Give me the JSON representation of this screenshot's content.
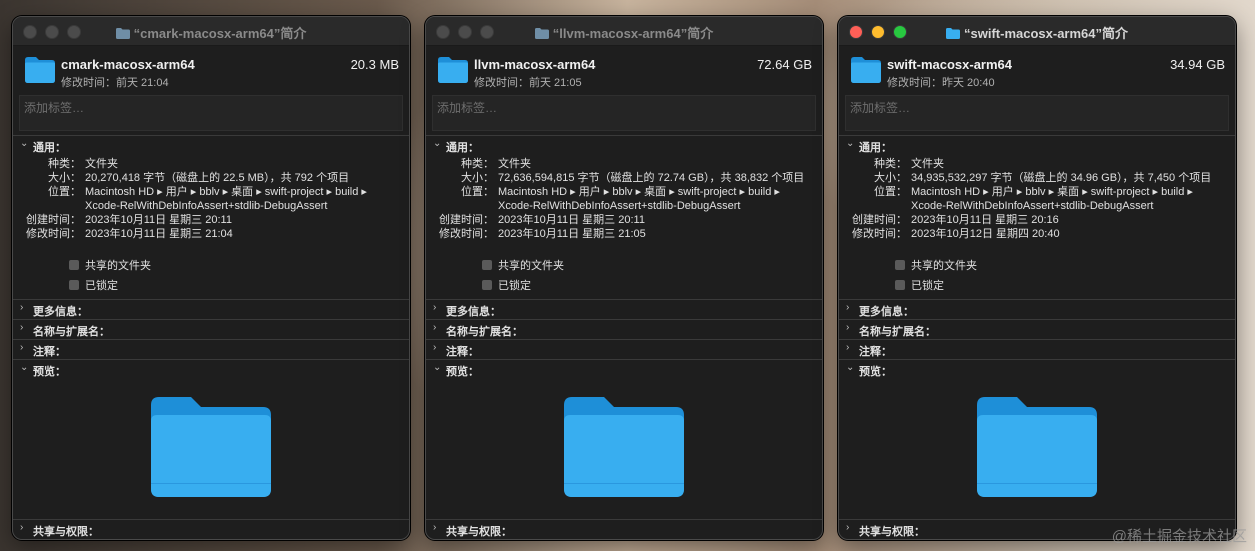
{
  "windows": [
    {
      "title": "“cmark-macosx-arm64”简介",
      "name": "cmark-macosx-arm64",
      "size": "20.3 MB",
      "modified_short": "修改时间：前天 21:04",
      "tags_placeholder": "添加标签…",
      "sections": {
        "general": "通用：",
        "more_info": "更多信息：",
        "name_ext": "名称与扩展名：",
        "comments": "注释：",
        "preview": "预览：",
        "sharing": "共享与权限："
      },
      "kind_label": "种类：",
      "kind_value": "文件夹",
      "size_label": "大小：",
      "size_value": "20,270,418 字节（磁盘上的 22.5 MB），共 792 个项目",
      "where_label": "位置：",
      "where_value_1": "Macintosh HD ▸ 用户 ▸ bblv ▸ 桌面 ▸ swift-project ▸ build ▸",
      "where_value_2": "Xcode-RelWithDebInfoAssert+stdlib-DebugAssert",
      "created_label": "创建时间：",
      "created_value": "2023年10月11日 星期三 20:11",
      "modified_label": "修改时间：",
      "modified_value": "2023年10月11日 星期三 21:04",
      "shared_folder": "共享的文件夹",
      "locked": "已锁定"
    },
    {
      "title": "“llvm-macosx-arm64”简介",
      "name": "llvm-macosx-arm64",
      "size": "72.64 GB",
      "modified_short": "修改时间：前天 21:05",
      "tags_placeholder": "添加标签…",
      "sections": {
        "general": "通用：",
        "more_info": "更多信息：",
        "name_ext": "名称与扩展名：",
        "comments": "注释：",
        "preview": "预览：",
        "sharing": "共享与权限："
      },
      "kind_label": "种类：",
      "kind_value": "文件夹",
      "size_label": "大小：",
      "size_value": "72,636,594,815 字节（磁盘上的 72.74 GB），共 38,832 个项目",
      "where_label": "位置：",
      "where_value_1": "Macintosh HD ▸ 用户 ▸ bblv ▸ 桌面 ▸ swift-project ▸ build ▸",
      "where_value_2": "Xcode-RelWithDebInfoAssert+stdlib-DebugAssert",
      "created_label": "创建时间：",
      "created_value": "2023年10月11日 星期三 20:11",
      "modified_label": "修改时间：",
      "modified_value": "2023年10月11日 星期三 21:05",
      "shared_folder": "共享的文件夹",
      "locked": "已锁定"
    },
    {
      "title": "“swift-macosx-arm64”简介",
      "name": "swift-macosx-arm64",
      "size": "34.94 GB",
      "modified_short": "修改时间：昨天 20:40",
      "tags_placeholder": "添加标签…",
      "sections": {
        "general": "通用：",
        "more_info": "更多信息：",
        "name_ext": "名称与扩展名：",
        "comments": "注释：",
        "preview": "预览：",
        "sharing": "共享与权限："
      },
      "kind_label": "种类：",
      "kind_value": "文件夹",
      "size_label": "大小：",
      "size_value": "34,935,532,297 字节（磁盘上的 34.96 GB），共 7,450 个项目",
      "where_label": "位置：",
      "where_value_1": "Macintosh HD ▸ 用户 ▸ bblv ▸ 桌面 ▸ swift-project ▸ build ▸",
      "where_value_2": "Xcode-RelWithDebInfoAssert+stdlib-DebugAssert",
      "created_label": "创建时间：",
      "created_value": "2023年10月11日 星期三 20:16",
      "modified_label": "修改时间：",
      "modified_value": "2023年10月12日 星期四 20:40",
      "shared_folder": "共享的文件夹",
      "locked": "已锁定"
    }
  ],
  "watermark": "@稀土掘金技术社区",
  "colors": {
    "folder_blue": "#38aef0",
    "folder_blue_dark": "#1e8fd8",
    "close": "#fe5f57",
    "minimize": "#febc2e",
    "zoom": "#28c840"
  }
}
